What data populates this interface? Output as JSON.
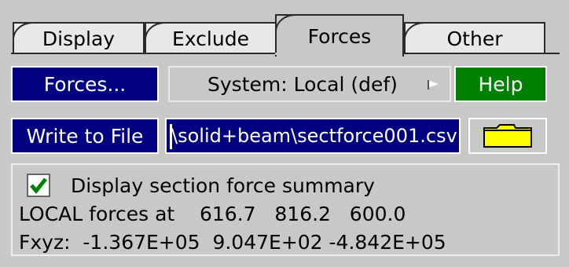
{
  "tabs": [
    {
      "label": "Display",
      "active": false
    },
    {
      "label": "Exclude",
      "active": false
    },
    {
      "label": "Forces",
      "active": true
    },
    {
      "label": "Other",
      "active": false
    }
  ],
  "toolbar": {
    "forces_label": "Forces...",
    "system_label": "System: Local (def)",
    "help_label": "Help"
  },
  "file": {
    "write_label": "Write to File",
    "path_value": "\\solid+beam\\sectforce001.csv",
    "folder_icon": "folder-icon"
  },
  "summary": {
    "checkbox_checked": true,
    "checkbox_label": "Display section force summary",
    "local_line": "LOCAL forces at    616.7   816.2   600.0",
    "fxyz_line": "Fxyz:  -1.367E+05  9.047E+02 -4.842E+05"
  },
  "colors": {
    "panel": "#c8c8c8",
    "blue_button": "#000080",
    "green_button": "#008000",
    "folder": "#ffff00",
    "check": "#008000"
  }
}
